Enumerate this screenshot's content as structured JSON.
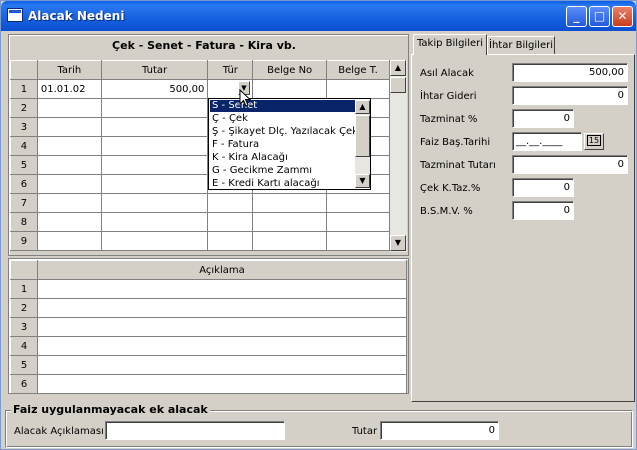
{
  "window": {
    "title": "Alacak Nedeni",
    "minimize_glyph": "_",
    "maximize_glyph": "□",
    "close_glyph": "✕"
  },
  "grid1": {
    "title": "Çek - Senet - Fatura - Kira vb.",
    "columns": [
      "Tarih",
      "Tutar",
      "Tür",
      "Belge No",
      "Belge T."
    ],
    "rows": [
      {
        "num": "1",
        "tarih": "01.01.02",
        "tutar": "500,00"
      },
      {
        "num": "2",
        "tarih": "",
        "tutar": ""
      },
      {
        "num": "3",
        "tarih": "",
        "tutar": ""
      },
      {
        "num": "4",
        "tarih": "",
        "tutar": ""
      },
      {
        "num": "5",
        "tarih": "",
        "tutar": ""
      },
      {
        "num": "6",
        "tarih": "",
        "tutar": ""
      },
      {
        "num": "7",
        "tarih": "",
        "tutar": ""
      },
      {
        "num": "8",
        "tarih": "",
        "tutar": ""
      },
      {
        "num": "9",
        "tarih": "",
        "tutar": ""
      }
    ]
  },
  "tur_dropdown": {
    "items": [
      "S - Senet",
      "Ç - Çek",
      "Ş - Şikayet Dlç. Yazılacak Çek",
      "F - Fatura",
      "K - Kira Alacağı",
      "G - Gecikme Zammı",
      "E - Kredi Kartı alacağı"
    ],
    "selected_index": 0
  },
  "grid2": {
    "column": "Açıklama",
    "rows": [
      "1",
      "2",
      "3",
      "4",
      "5",
      "6"
    ]
  },
  "tabs": [
    {
      "label": "Takip Bilgileri",
      "active": true
    },
    {
      "label": "İhtar Bilgileri",
      "active": false
    }
  ],
  "takip": {
    "asil_alacak": {
      "label": "Asıl Alacak",
      "value": "500,00"
    },
    "ihtar_gideri": {
      "label": "İhtar Gideri",
      "value": "0"
    },
    "tazminat_pct": {
      "label": "Tazminat %",
      "value": "0"
    },
    "faiz_bas_tarihi": {
      "label": "Faiz Baş.Tarihi",
      "value": "__.__.____",
      "calendar_label": "15"
    },
    "tazminat_tutari": {
      "label": "Tazminat Tutarı",
      "value": "0"
    },
    "cek_k_taz": {
      "label": "Çek K.Taz.%",
      "value": "0"
    },
    "bsmv": {
      "label": "B.S.M.V. %",
      "value": "0"
    }
  },
  "ek_alacak": {
    "title": "Faiz uygulanmayacak ek alacak",
    "aciklama_label": "Alacak Açıklaması",
    "aciklama_value": "",
    "tutar_label": "Tutar",
    "tutar_value": "0"
  }
}
